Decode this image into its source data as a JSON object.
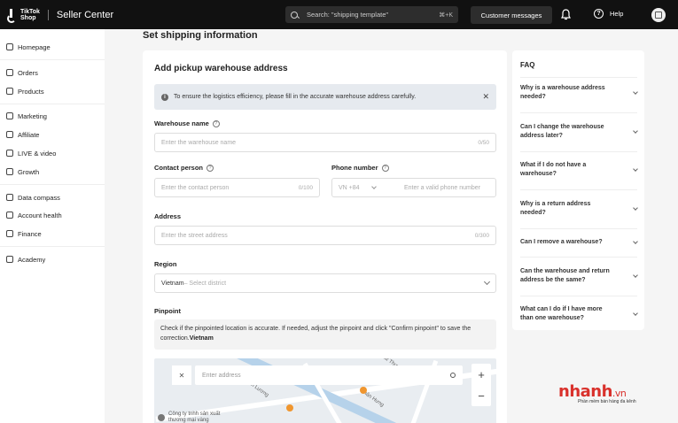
{
  "header": {
    "brand": "TikTok\nShop",
    "title": "Seller Center",
    "search_placeholder": "Search: \"shipping template\"",
    "search_shortcut": "⌘+K",
    "customer_messages": "Customer messages",
    "help": "Help"
  },
  "sidebar": {
    "items": [
      {
        "label": "Homepage",
        "icon": "home-icon"
      },
      {
        "label": "Orders",
        "icon": "orders-icon"
      },
      {
        "label": "Products",
        "icon": "products-icon"
      },
      {
        "label": "Marketing",
        "icon": "marketing-icon"
      },
      {
        "label": "Affiliate",
        "icon": "affiliate-icon"
      },
      {
        "label": "LIVE & video",
        "icon": "live-icon"
      },
      {
        "label": "Growth",
        "icon": "growth-icon"
      },
      {
        "label": "Data compass",
        "icon": "data-icon"
      },
      {
        "label": "Account health",
        "icon": "health-icon"
      },
      {
        "label": "Finance",
        "icon": "finance-icon"
      },
      {
        "label": "Academy",
        "icon": "academy-icon"
      }
    ]
  },
  "page": {
    "title": "Set shipping information",
    "card_title": "Add pickup warehouse address",
    "notice": "To ensure the logistics efficiency, please fill in the accurate warehouse address carefully.",
    "warehouse_label": "Warehouse name",
    "warehouse_placeholder": "Enter the warehouse name",
    "warehouse_count": "0/50",
    "contact_label": "Contact person",
    "contact_placeholder": "Enter the contact person",
    "contact_count": "0/100",
    "phone_label": "Phone number",
    "phone_code": "VN +84",
    "phone_placeholder": "Enter a valid phone number",
    "address_label": "Address",
    "address_placeholder": "Enter the street address",
    "address_count": "0/300",
    "region_label": "Region",
    "region_country": "Vietnam",
    "region_placeholder": " – Select district",
    "pinpoint_label": "Pinpoint",
    "pinpoint_text": "Check if the pinpointed location is accurate. If needed, adjust the pinpoint and click \"Confirm pinpoint\" to save the correction.",
    "pinpoint_country": "Vietnam",
    "map_search_placeholder": "Enter address",
    "map_labels": [
      "Tôn Thất Thuyệt",
      "Công ty tnhh sản xuất thương mại vàng",
      "Cầu Thầm Lương",
      "Nhân Hưng"
    ]
  },
  "faq": {
    "title": "FAQ",
    "items": [
      "Why is a warehouse address needed?",
      "Can I change the warehouse address later?",
      "What if I do not have a warehouse?",
      "Why is a return address needed?",
      "Can I remove a warehouse?",
      "Can the warehouse and return address be the same?",
      "What can I do if I have more than one warehouse?"
    ]
  },
  "watermark": {
    "logo": "nhanh",
    "tld": ".vn",
    "tagline": "Phần mềm bán hàng đa kênh"
  }
}
